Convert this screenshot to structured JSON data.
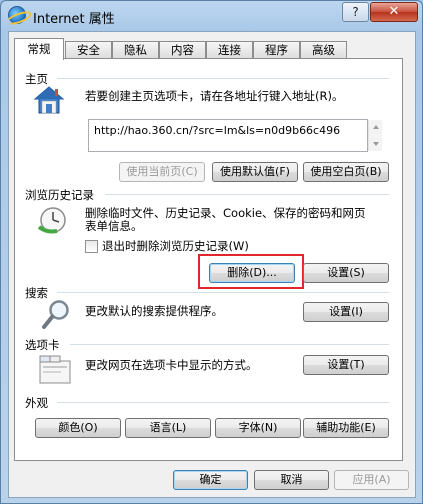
{
  "window": {
    "title": "Internet 属性",
    "help_label": "?",
    "close_label": "✕"
  },
  "tabs": [
    {
      "label": "常规",
      "active": true
    },
    {
      "label": "安全"
    },
    {
      "label": "隐私"
    },
    {
      "label": "内容"
    },
    {
      "label": "连接"
    },
    {
      "label": "程序"
    },
    {
      "label": "高级"
    }
  ],
  "home": {
    "group_label": "主页",
    "description": "若要创建主页选项卡，请在各地址行键入地址(R)。",
    "url": "http://hao.360.cn/?src=lm&ls=n0d9b66c496",
    "use_current_label": "使用当前页(C)",
    "use_default_label": "使用默认值(F)",
    "use_blank_label": "使用空白页(B)"
  },
  "history": {
    "group_label": "浏览历史记录",
    "description_line1": "删除临时文件、历史记录、Cookie、保存的密码和网页",
    "description_line2": "表单信息。",
    "delete_on_exit_label": "退出时删除浏览历史记录(W)",
    "delete_label": "删除(D)...",
    "settings_label": "设置(S)"
  },
  "search": {
    "group_label": "搜索",
    "description": "更改默认的搜索提供程序。",
    "settings_label": "设置(I)"
  },
  "tabs_group": {
    "group_label": "选项卡",
    "description": "更改网页在选项卡中显示的方式。",
    "settings_label": "设置(T)"
  },
  "appearance": {
    "group_label": "外观",
    "colors_label": "颜色(O)",
    "languages_label": "语言(L)",
    "fonts_label": "字体(N)",
    "accessibility_label": "辅助功能(E)"
  },
  "footer": {
    "ok_label": "确定",
    "cancel_label": "取消",
    "apply_label": "应用(A)"
  },
  "colors": {
    "highlight_border": "#e1262d"
  }
}
